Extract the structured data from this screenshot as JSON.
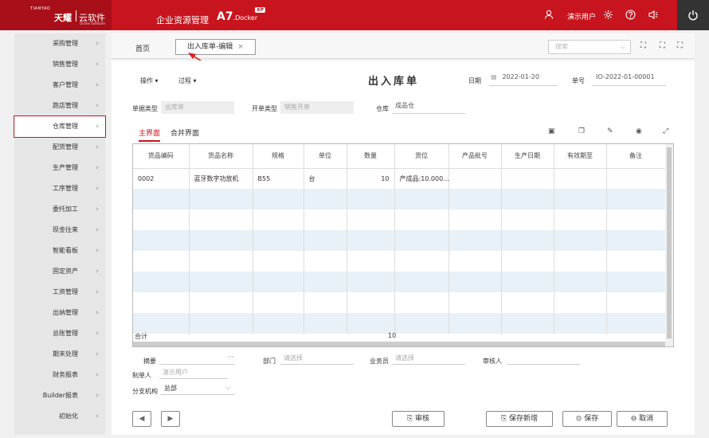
{
  "header": {
    "brand_en": "TIANYAO",
    "brand": "天耀",
    "cloud": "云软件",
    "cloud_sub": "Online Software",
    "app_title": "企业资源管理",
    "product": "A7",
    "product_sub": ".Docker",
    "badge": "XP",
    "user": "演示用户"
  },
  "sidebar": {
    "items": [
      {
        "label": "采购管理"
      },
      {
        "label": "销售管理"
      },
      {
        "label": "客户管理"
      },
      {
        "label": "跑店管理"
      },
      {
        "label": "仓库管理",
        "active": true
      },
      {
        "label": "配货管理"
      },
      {
        "label": "生产管理"
      },
      {
        "label": "工序管理"
      },
      {
        "label": "委托加工"
      },
      {
        "label": "现金往来"
      },
      {
        "label": "智能看板"
      },
      {
        "label": "固定资产"
      },
      {
        "label": "工资管理"
      },
      {
        "label": "出纳管理"
      },
      {
        "label": "总账管理"
      },
      {
        "label": "期末处理"
      },
      {
        "label": "财务报表"
      },
      {
        "label": "Builder报表"
      },
      {
        "label": "初始化"
      }
    ]
  },
  "tabs": {
    "home": "首页",
    "active": "出入库单-编辑",
    "close": "×"
  },
  "search": {
    "placeholder": "搜索"
  },
  "form": {
    "operate": "操作",
    "process": "过程",
    "title": "出入库单",
    "date_label": "日期",
    "date_value": "2022-01-20",
    "no_label": "单号",
    "no_value": "IO-2022-01-00001",
    "doc_type_label": "单据类型",
    "doc_type_value": "出库单",
    "open_type_label": "开单类型",
    "open_type_value": "销售开单",
    "warehouse_label": "仓库",
    "warehouse_value": "成品仓"
  },
  "subtabs": {
    "main": "主界面",
    "merge": "合并界面"
  },
  "table": {
    "headers": [
      "货品编码",
      "货品名称",
      "规格",
      "单位",
      "数量",
      "货位",
      "产品批号",
      "生产日期",
      "有效期至",
      "备注"
    ],
    "row": [
      "0002",
      "蓝牙数字功放机",
      "B55",
      "台",
      "10",
      "产成品:10.000...",
      "",
      "",
      "",
      ""
    ],
    "total_label": "合计",
    "total_qty": "10"
  },
  "footer": {
    "summary_label": "摘要",
    "summary_more": "···",
    "dept_label": "部门",
    "dept_placeholder": "请选择",
    "salesman_label": "业务员",
    "salesman_placeholder": "请选择",
    "reviewer_label": "审核人",
    "maker_label": "制单人",
    "maker_value": "演示用户",
    "branch_label": "分支机构",
    "branch_value": "总部"
  },
  "buttons": {
    "audit": "审核",
    "save_new": "保存新增",
    "save": "保存",
    "cancel": "取消",
    "prev": "◀",
    "next": "▶"
  }
}
